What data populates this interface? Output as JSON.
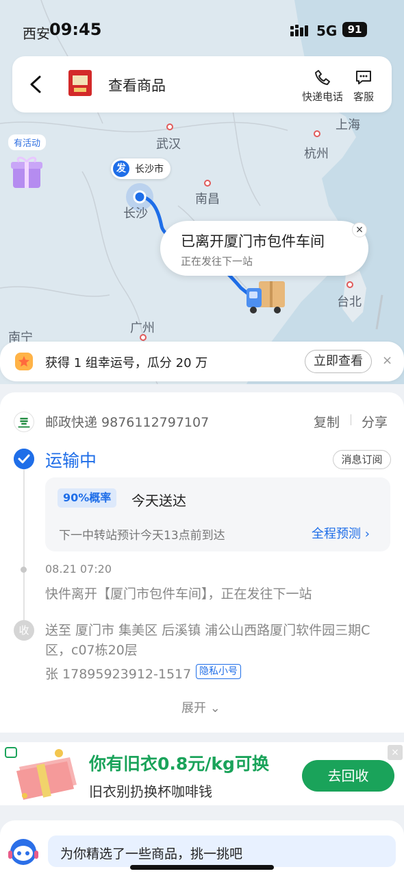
{
  "status_bar": {
    "location": "西安",
    "time": "09:45",
    "network": "5G",
    "battery": "91"
  },
  "header": {
    "title": "查看商品",
    "call_label": "快递电话",
    "service_label": "客服"
  },
  "map": {
    "activity_label": "有活动",
    "origin_tag": "发",
    "origin_city": "长沙市",
    "cities": [
      "上海",
      "武汉",
      "杭州",
      "长沙",
      "南昌",
      "台北",
      "广州",
      "南宁"
    ],
    "popup": {
      "title": "已离开厦门市包件车间",
      "subtitle": "正在发往下一站"
    }
  },
  "lucky": {
    "text": "获得 1 组幸运号，瓜分 20 万",
    "button": "立即查看",
    "close": "×"
  },
  "shipment": {
    "carrier": "邮政快递 9876112797107",
    "copy": "复制",
    "share": "分享",
    "status": "运输中",
    "subscribe": "消息订阅",
    "probability": "90%概率",
    "eta": "今天送达",
    "next_stop": "下一中转站预计今天13点前到达",
    "forecast": "全程预测 ›",
    "event_time": "08.21 07:20",
    "event_desc": "快件离开【厦门市包件车间】，正在发往下一站",
    "recv_icon": "收",
    "address": "送至 厦门市 集美区 后溪镇 浦公山西路厦门软件园三期C区，c07栋20层",
    "phone": "张 17895923912-1517",
    "privacy": "隐私小号",
    "expand": "展开 ⌄"
  },
  "ad": {
    "title": "你有旧衣0.8元/kg可换",
    "subtitle": "旧衣别扔换杯咖啡钱",
    "button": "去回收",
    "close": "×"
  },
  "recommend": {
    "text": "为你精选了一些商品，挑一挑吧"
  },
  "colors": {
    "accent": "#1f6ee8",
    "green": "#1aa35a"
  }
}
